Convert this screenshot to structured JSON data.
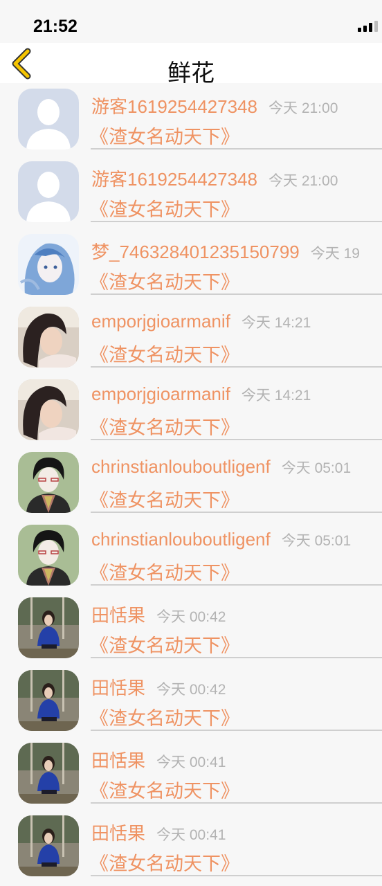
{
  "status_bar": {
    "time": "21:52",
    "signal_icon": "cellular-signal-icon"
  },
  "nav": {
    "back_icon": "chevron-left-icon",
    "title": "鲜花",
    "accent_color": "#f5c400"
  },
  "colors": {
    "name": "#ef9363",
    "work": "#ef9363",
    "time": "#b3b3b3"
  },
  "gifts": [
    {
      "name": "游客1619254427348",
      "time": "今天 21:00",
      "work": "《渣女名动天下》",
      "avatar": "default-avatar-icon"
    },
    {
      "name": "游客1619254427348",
      "time": "今天 21:00",
      "work": "《渣女名动天下》",
      "avatar": "default-avatar-icon"
    },
    {
      "name": "梦_746328401235150799",
      "time": "今天 19",
      "work": "《渣女名动天下》",
      "avatar": "anime-girl-avatar"
    },
    {
      "name": "emporjgioarmanif",
      "time": "今天 14:21",
      "work": "《渣女名动天下》",
      "avatar": "girl-photo-avatar"
    },
    {
      "name": "emporjgioarmanif",
      "time": "今天 14:21",
      "work": "《渣女名动天下》",
      "avatar": "girl-photo-avatar"
    },
    {
      "name": "chrinstianlouboutligenf",
      "time": "今天 05:01",
      "work": "《渣女名动天下》",
      "avatar": "anime-boy-avatar"
    },
    {
      "name": "chrinstianlouboutligenf",
      "time": "今天 05:01",
      "work": "《渣女名动天下》",
      "avatar": "anime-boy-avatar"
    },
    {
      "name": "田恬果",
      "time": "今天 00:42",
      "work": "《渣女名动天下》",
      "avatar": "swing-photo-avatar"
    },
    {
      "name": "田恬果",
      "time": "今天 00:42",
      "work": "《渣女名动天下》",
      "avatar": "swing-photo-avatar"
    },
    {
      "name": "田恬果",
      "time": "今天 00:41",
      "work": "《渣女名动天下》",
      "avatar": "swing-photo-avatar"
    },
    {
      "name": "田恬果",
      "time": "今天 00:41",
      "work": "《渣女名动天下》",
      "avatar": "swing-photo-avatar"
    }
  ]
}
